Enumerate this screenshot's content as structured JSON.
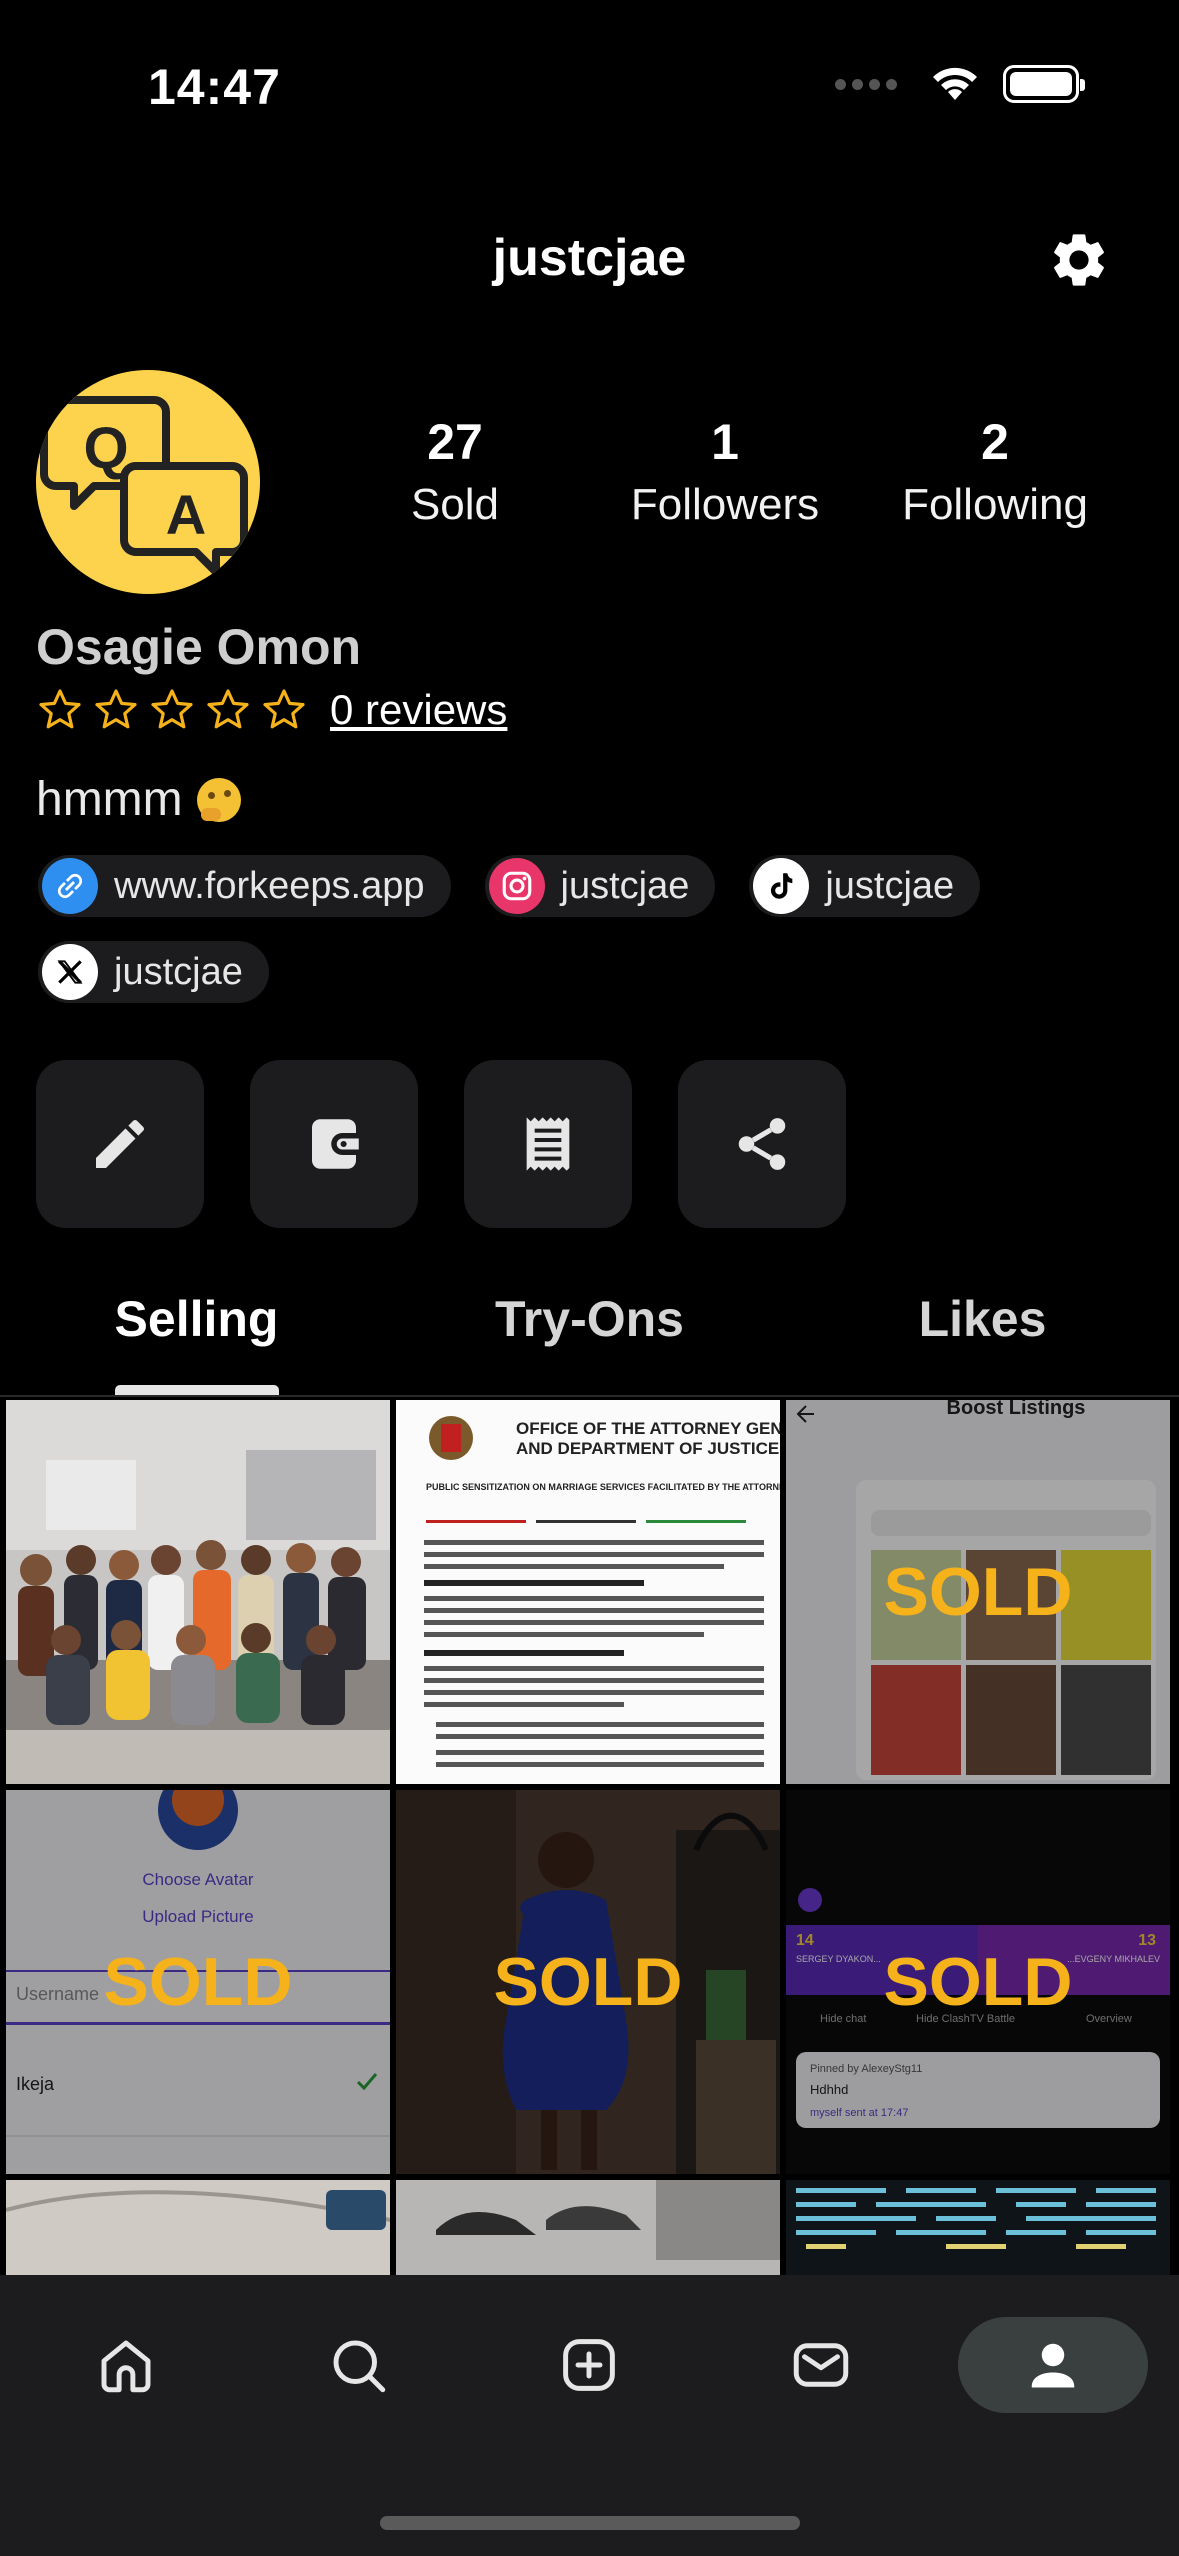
{
  "status_bar": {
    "time": "14:47"
  },
  "header": {
    "title": "justcjae",
    "settings_icon": "gear-icon"
  },
  "profile": {
    "name": "Osagie Omon",
    "avatar_icon": "qa-chat-icon",
    "avatar_color": "#fdd34d",
    "stats": [
      {
        "value": "27",
        "label": "Sold"
      },
      {
        "value": "1",
        "label": "Followers"
      },
      {
        "value": "2",
        "label": "Following"
      }
    ],
    "rating": {
      "stars": 0,
      "max_stars": 5,
      "reviews_label": "0 reviews"
    },
    "bio": "hmmm",
    "bio_emoji": "thinking-face-icon",
    "links": [
      {
        "icon": "link-icon",
        "label": "www.forkeeps.app",
        "color": "#2f8ff0"
      },
      {
        "icon": "instagram-icon",
        "label": "justcjae",
        "color": "#e8366b"
      },
      {
        "icon": "tiktok-icon",
        "label": "justcjae",
        "color": "#ffffff"
      },
      {
        "icon": "x-icon",
        "label": "justcjae",
        "color": "#ffffff"
      }
    ]
  },
  "actions": [
    {
      "icon": "pencil-icon",
      "name": "edit-profile-button"
    },
    {
      "icon": "wallet-icon",
      "name": "wallet-button"
    },
    {
      "icon": "receipt-icon",
      "name": "orders-button"
    },
    {
      "icon": "share-icon",
      "name": "share-button"
    }
  ],
  "tabs": [
    {
      "label": "Selling",
      "active": true
    },
    {
      "label": "Try-Ons",
      "active": false
    },
    {
      "label": "Likes",
      "active": false
    }
  ],
  "listings": [
    {
      "description": "group photo",
      "sold": false
    },
    {
      "description": "office of the attorney general document",
      "sold": false
    },
    {
      "description": "boost listings screenshot",
      "sold": true,
      "sold_label": "SOLD"
    },
    {
      "description": "choose avatar screenshot",
      "sold": true,
      "sold_label": "SOLD"
    },
    {
      "description": "person in blue dress",
      "sold": true,
      "sold_label": "SOLD"
    },
    {
      "description": "live stream screenshot",
      "sold": true,
      "sold_label": "SOLD"
    },
    {
      "description": "car interior",
      "sold": false
    },
    {
      "description": "sneakers",
      "sold": false
    },
    {
      "description": "code screen",
      "sold": false
    }
  ],
  "listing_texts": {
    "doc_header_1": "OFFICE OF THE ATTORNEY GENERAL",
    "doc_header_2": "AND DEPARTMENT OF JUSTICE",
    "doc_subtitle": "PUBLIC SENSITIZATION ON MARRIAGE SERVICES FACILITATED BY THE ATTORNEY GENERAL",
    "boost_title": "Boost Listings",
    "avatar_choose": "Choose Avatar",
    "avatar_upload": "Upload Picture",
    "avatar_username": "Username",
    "avatar_location": "Ikeja",
    "stream_left": "14",
    "stream_right": "13",
    "stream_name_left": "SERGEY DYAKON...",
    "stream_name_right": "...EVGENY MIKHALEV",
    "stream_hide_chat": "Hide chat",
    "stream_hide_battle": "Hide ClashTV Battle",
    "stream_overview": "Overview",
    "stream_pinned": "Pinned by AlexeyStg11",
    "stream_msg": "Hdhhd",
    "stream_sent": "myself sent at 17:47"
  },
  "nav": [
    {
      "icon": "home-icon",
      "active": false
    },
    {
      "icon": "search-icon",
      "active": false
    },
    {
      "icon": "add-listing-icon",
      "active": false
    },
    {
      "icon": "inbox-icon",
      "active": false
    },
    {
      "icon": "profile-icon",
      "active": true
    }
  ]
}
